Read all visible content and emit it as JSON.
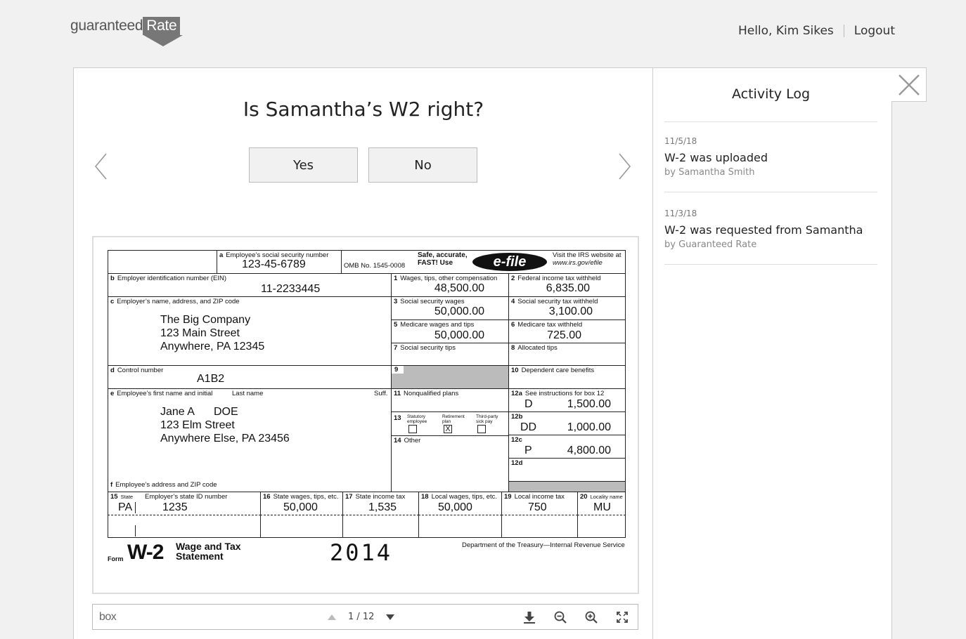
{
  "header": {
    "logo_main": "guaranteed",
    "logo_box": "Rate",
    "greeting": "Hello, Kim Sikes",
    "logout": "Logout"
  },
  "main": {
    "question": "Is Samantha’s W2 right?",
    "yes_label": "Yes",
    "no_label": "No"
  },
  "viewer": {
    "brand": "box",
    "page_indicator": "1 / 12"
  },
  "activity_log": {
    "title": "Activity Log",
    "entries": [
      {
        "date": "11/5/18",
        "text": "W-2 was uploaded",
        "by": "by Samantha Smith"
      },
      {
        "date": "11/3/18",
        "text": "W-2 was requested from Samantha",
        "by": "by Guaranteed Rate"
      }
    ]
  },
  "w2": {
    "ssn_label": "Employee’s social security number",
    "ssn": "123-45-6789",
    "omb": "OMB No. 1545-0008",
    "safe": "Safe, accurate,",
    "fast": "FAST! Use",
    "efile": "e-file",
    "irs_visit": "Visit the IRS website at",
    "irs_url": "www.irs.gov/efile",
    "ein_label": "Employer identification number (EIN)",
    "ein": "11-2233445",
    "employer_label": "Employer’s name, address, and ZIP code",
    "employer_name": "The Big Company",
    "employer_street": "123 Main Street",
    "employer_city": "Anywhere, PA 12345",
    "control_label": "Control number",
    "control": "A1B2",
    "employee_label": "Employee’s first name and initial",
    "last_name_label": "Last name",
    "suff_label": "Suff.",
    "employee_first": "Jane A",
    "employee_last": "DOE",
    "employee_street": "123 Elm Street",
    "employee_city": "Anywhere Else, PA 23456",
    "employee_addr_label": "Employee’s address and ZIP code",
    "box1_label": "Wages, tips, other compensation",
    "box1": "48,500.00",
    "box2_label": "Federal income tax withheld",
    "box2": "6,835.00",
    "box3_label": "Social security wages",
    "box3": "50,000.00",
    "box4_label": "Social security tax withheld",
    "box4": "3,100.00",
    "box5_label": "Medicare wages and tips",
    "box5": "50,000.00",
    "box6_label": "Medicare tax withheld",
    "box6": "725.00",
    "box7_label": "Social security tips",
    "box8_label": "Allocated tips",
    "box10_label": "Dependent care benefits",
    "box11_label": "Nonqualified plans",
    "box12a_label": "See instructions for box 12",
    "box12a_code": "D",
    "box12a_amt": "1,500.00",
    "box12b_code": "DD",
    "box12b_amt": "1,000.00",
    "box12c_code": "P",
    "box12c_amt": "4,800.00",
    "box13_statutory": "Statutory employee",
    "box13_retirement": "Retirement plan",
    "box13_thirdparty": "Third-party sick pay",
    "box13_mark": "X",
    "box14_label": "Other",
    "box15_label": "State",
    "box15_id_label": "Employer’s state ID number",
    "state": "PA",
    "state_id": "1235",
    "box16_label": "State wages, tips, etc.",
    "box16": "50,000",
    "box17_label": "State income tax",
    "box17": "1,535",
    "box18_label": "Local wages, tips, etc.",
    "box18": "50,000",
    "box19_label": "Local income tax",
    "box19": "750",
    "box20_label": "Locality name",
    "box20": "MU",
    "form_word": "Form",
    "form_name": "W-2",
    "form_title_1": "Wage and Tax",
    "form_title_2": "Statement",
    "year": "2014",
    "dept": "Department of the Treasury—Internal Revenue Service"
  }
}
